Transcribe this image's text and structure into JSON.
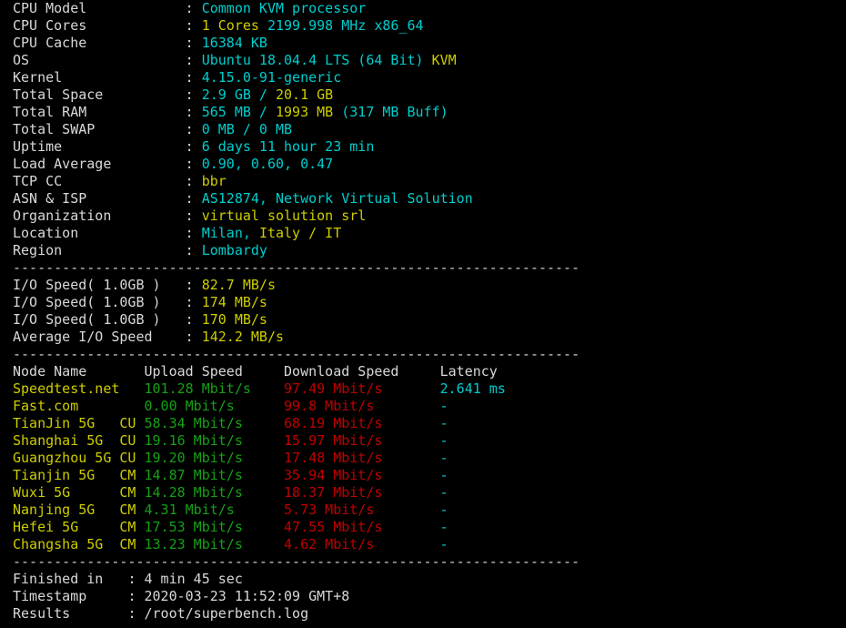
{
  "terminal": {
    "background": "#000000",
    "colors": {
      "label": "#d8d8d8",
      "cyan": "#00cdcd",
      "yellow": "#cdcd00",
      "green": "#16a016",
      "red": "#c00000",
      "separator": "#d0d0d0"
    },
    "separator": "---------------------------------------------------------------------"
  },
  "sysinfo": {
    "rows": [
      {
        "label": "CPU Model",
        "colon": ":",
        "value_cyan": "Common KVM processor",
        "value_yellow": ""
      },
      {
        "label": "CPU Cores",
        "colon": ":",
        "value_cyan": "",
        "value_yellow": "1 Cores",
        "value_cyan2": "2199.998 MHz x86_64"
      },
      {
        "label": "CPU Cache",
        "colon": ":",
        "value_cyan": "16384 KB",
        "value_yellow": ""
      },
      {
        "label": "OS",
        "colon": ":",
        "value_cyan": "Ubuntu 18.04.4 LTS (64 Bit)",
        "value_yellow": "KVM"
      },
      {
        "label": "Kernel",
        "colon": ":",
        "value_cyan": "4.15.0-91-generic",
        "value_yellow": ""
      },
      {
        "label": "Total Space",
        "colon": ":",
        "value_cyan": "2.9 GB /",
        "value_yellow": "20.1 GB"
      },
      {
        "label": "Total RAM",
        "colon": ":",
        "value_cyan": "565 MB /",
        "value_yellow": "1993 MB",
        "value_cyan2": "(317 MB Buff)"
      },
      {
        "label": "Total SWAP",
        "colon": ":",
        "value_cyan": "0 MB / 0 MB",
        "value_yellow": ""
      },
      {
        "label": "Uptime",
        "colon": ":",
        "value_cyan": "6 days 11 hour 23 min",
        "value_yellow": ""
      },
      {
        "label": "Load Average",
        "colon": ":",
        "value_cyan": "0.90, 0.60, 0.47",
        "value_yellow": ""
      },
      {
        "label": "TCP CC",
        "colon": ":",
        "value_cyan": "",
        "value_yellow": "bbr"
      },
      {
        "label": "ASN & ISP",
        "colon": ":",
        "value_cyan": "AS12874, Network Virtual Solution",
        "value_yellow": ""
      },
      {
        "label": "Organization",
        "colon": ":",
        "value_cyan": "",
        "value_yellow": "virtual solution srl"
      },
      {
        "label": "Location",
        "colon": ":",
        "value_cyan": "Milan,",
        "value_yellow": "Italy / IT"
      },
      {
        "label": "Region",
        "colon": ":",
        "value_cyan": "Lombardy",
        "value_yellow": ""
      }
    ]
  },
  "io": {
    "rows": [
      {
        "label": "I/O Speed( 1.0GB )",
        "colon": ":",
        "value": "82.7 MB/s"
      },
      {
        "label": "I/O Speed( 1.0GB )",
        "colon": ":",
        "value": "174 MB/s"
      },
      {
        "label": "I/O Speed( 1.0GB )",
        "colon": ":",
        "value": "170 MB/s"
      },
      {
        "label": "Average I/O Speed",
        "colon": ":",
        "value": "142.2 MB/s"
      }
    ]
  },
  "speedtest": {
    "headers": {
      "node": "Node Name",
      "upload": "Upload Speed",
      "download": "Download Speed",
      "latency": "Latency"
    },
    "rows": [
      {
        "node": "Speedtest.net",
        "upload": "101.28 Mbit/s",
        "download": "97.49 Mbit/s",
        "latency": "2.641 ms"
      },
      {
        "node": "Fast.com",
        "upload": "0.00 Mbit/s",
        "download": "99.8 Mbit/s",
        "latency": "-"
      },
      {
        "node": "TianJin 5G   CU",
        "upload": "58.34 Mbit/s",
        "download": "68.19 Mbit/s",
        "latency": "-"
      },
      {
        "node": "Shanghai 5G  CU",
        "upload": "19.16 Mbit/s",
        "download": "15.97 Mbit/s",
        "latency": "-"
      },
      {
        "node": "Guangzhou 5G CU",
        "upload": "19.20 Mbit/s",
        "download": "17.48 Mbit/s",
        "latency": "-"
      },
      {
        "node": "Tianjin 5G   CM",
        "upload": "14.87 Mbit/s",
        "download": "35.94 Mbit/s",
        "latency": "-"
      },
      {
        "node": "Wuxi 5G      CM",
        "upload": "14.28 Mbit/s",
        "download": "18.37 Mbit/s",
        "latency": "-"
      },
      {
        "node": "Nanjing 5G   CM",
        "upload": "4.31 Mbit/s",
        "download": "5.73 Mbit/s",
        "latency": "-"
      },
      {
        "node": "Hefei 5G     CM",
        "upload": "17.53 Mbit/s",
        "download": "47.55 Mbit/s",
        "latency": "-"
      },
      {
        "node": "Changsha 5G  CM",
        "upload": "13.23 Mbit/s",
        "download": "4.62 Mbit/s",
        "latency": "-"
      }
    ]
  },
  "footer": {
    "rows": [
      {
        "label": "Finished in",
        "colon": ":",
        "value": "4 min 45 sec"
      },
      {
        "label": "Timestamp",
        "colon": ":",
        "value": "2020-03-23 11:52:09 GMT+8"
      },
      {
        "label": "Results",
        "colon": ":",
        "value": "/root/superbench.log"
      }
    ]
  }
}
